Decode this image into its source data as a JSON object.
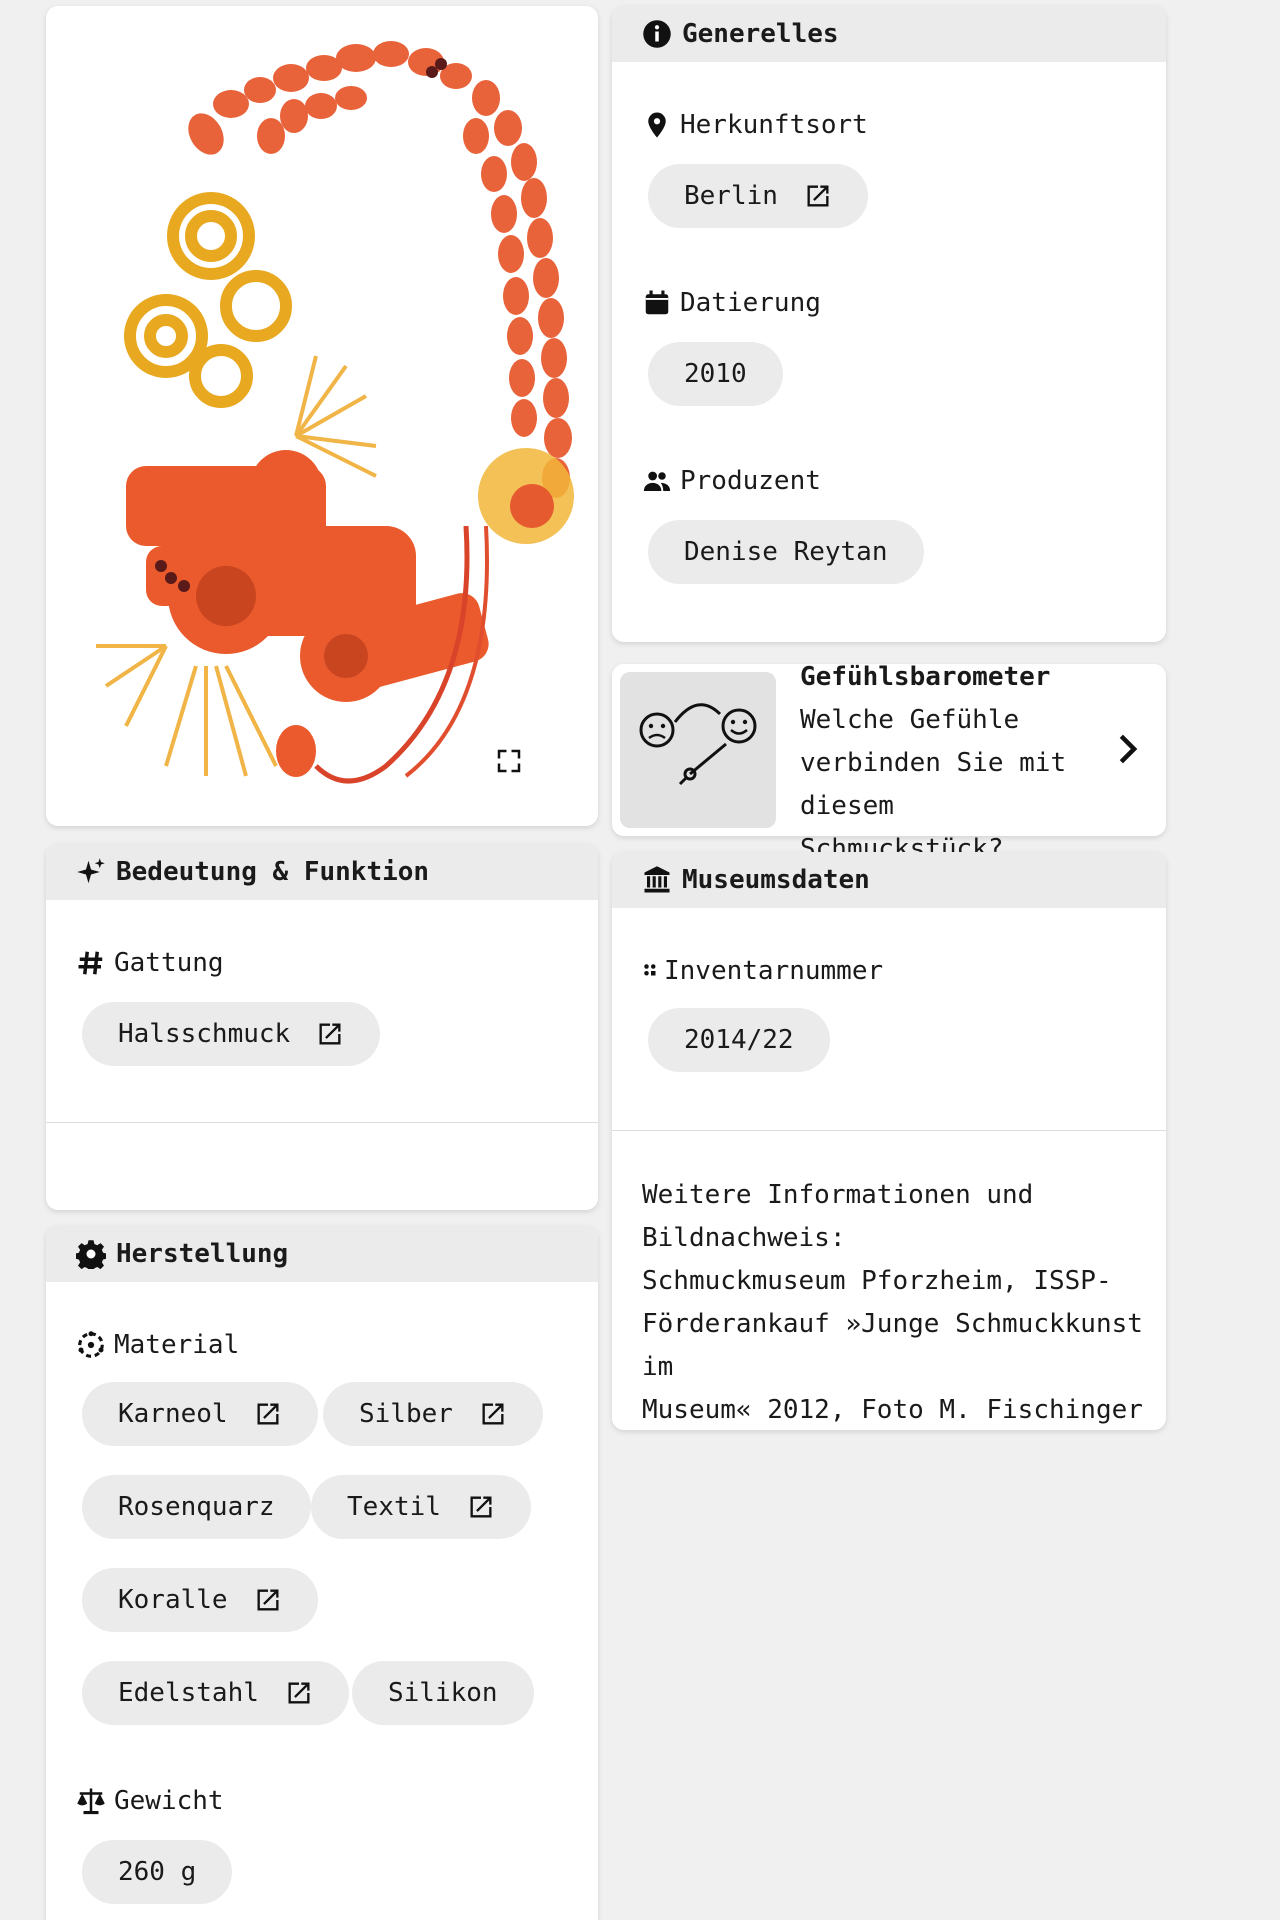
{
  "generelles": {
    "title": "Generelles",
    "herkunftsort_label": "Herkunftsort",
    "herkunftsort_value": "Berlin",
    "datierung_label": "Datierung",
    "datierung_value": "2010",
    "produzent_label": "Produzent",
    "produzent_value": "Denise Reytan"
  },
  "barometer": {
    "title": "Gefühlsbarometer",
    "text": "Welche Gefühle verbinden Sie mit diesem Schmuckstück?"
  },
  "bedeutung": {
    "title": "Bedeutung & Funktion",
    "gattung_label": "Gattung",
    "gattung_value": "Halsschmuck"
  },
  "museumsdaten": {
    "title": "Museumsdaten",
    "inventar_label": "Inventarnummer",
    "inventar_value": "2014/22",
    "info_line1": "Weitere Informationen und",
    "info_line2": "Bildnachweis:",
    "info_line3": "Schmuckmuseum Pforzheim, ISSP-",
    "info_line4": "Förderankauf »Junge Schmuckkunst im",
    "info_line5": "Museum« 2012, Foto M. Fischinger"
  },
  "herstellung": {
    "title": "Herstellung",
    "material_label": "Material",
    "materials": [
      "Karneol",
      "Silber",
      "Rosenquarz",
      "Textil",
      "Koralle",
      "Edelstahl",
      "Silikon"
    ],
    "gewicht_label": "Gewicht",
    "gewicht_value": "260 g"
  },
  "icons": {
    "info": "info-icon",
    "location": "location-pin-icon",
    "calendar": "calendar-icon",
    "people": "people-icon",
    "sparkles": "sparkles-icon",
    "hash": "hash-icon",
    "museum": "museum-icon",
    "gear": "gear-icon",
    "material": "material-icon",
    "scale": "scale-icon",
    "external": "external-link-icon",
    "expand": "expand-icon",
    "chevron": "chevron-right-icon"
  }
}
